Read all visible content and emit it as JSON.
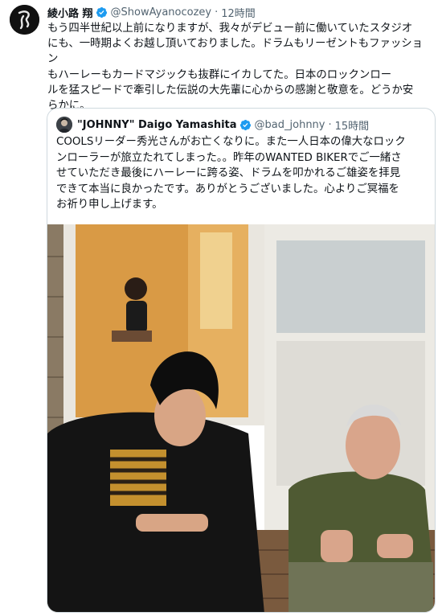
{
  "tweet": {
    "display_name": "綾小路 翔",
    "handle": "@ShowAyanocozey",
    "separator": "·",
    "time": "12時間",
    "lines": [
      "もう四半世紀以上前になりますが、我々がデビュー前に働いていたスタジオ",
      "にも、一時期よくお越し頂いておりました。ドラムもリーゼントもファッション",
      "もハーレーもカードマジックも抜群にイカしてた。日本のロックンロー",
      "ルを猛スピードで牽引した伝説の大先輩に心からの感謝と敬意を。どうか安",
      "らかに。"
    ]
  },
  "quoted": {
    "display_name": "\"JOHNNY\" Daigo Yamashita",
    "handle": "@bad_johnny",
    "separator": "·",
    "time": "15時間",
    "lines": [
      "COOLSリーダー秀光さんがお亡くなりに。また一人日本の偉大なロック",
      "ンローラーが旅立たれてしまった。。昨年のWANTED BIKERでご一緒さ",
      "せていただき最後にハーレーに跨る姿、ドラムを叩かれるご雄姿を拝見",
      "できて本当に良かったです。ありがとうございました。心よりご冥福を",
      "お祈り申し上げます。"
    ]
  },
  "colors": {
    "verified": "#1d9bf0",
    "secondary_text": "#536471",
    "border": "#cfd9de"
  },
  "icons": {
    "verified": "verified-badge-icon"
  }
}
